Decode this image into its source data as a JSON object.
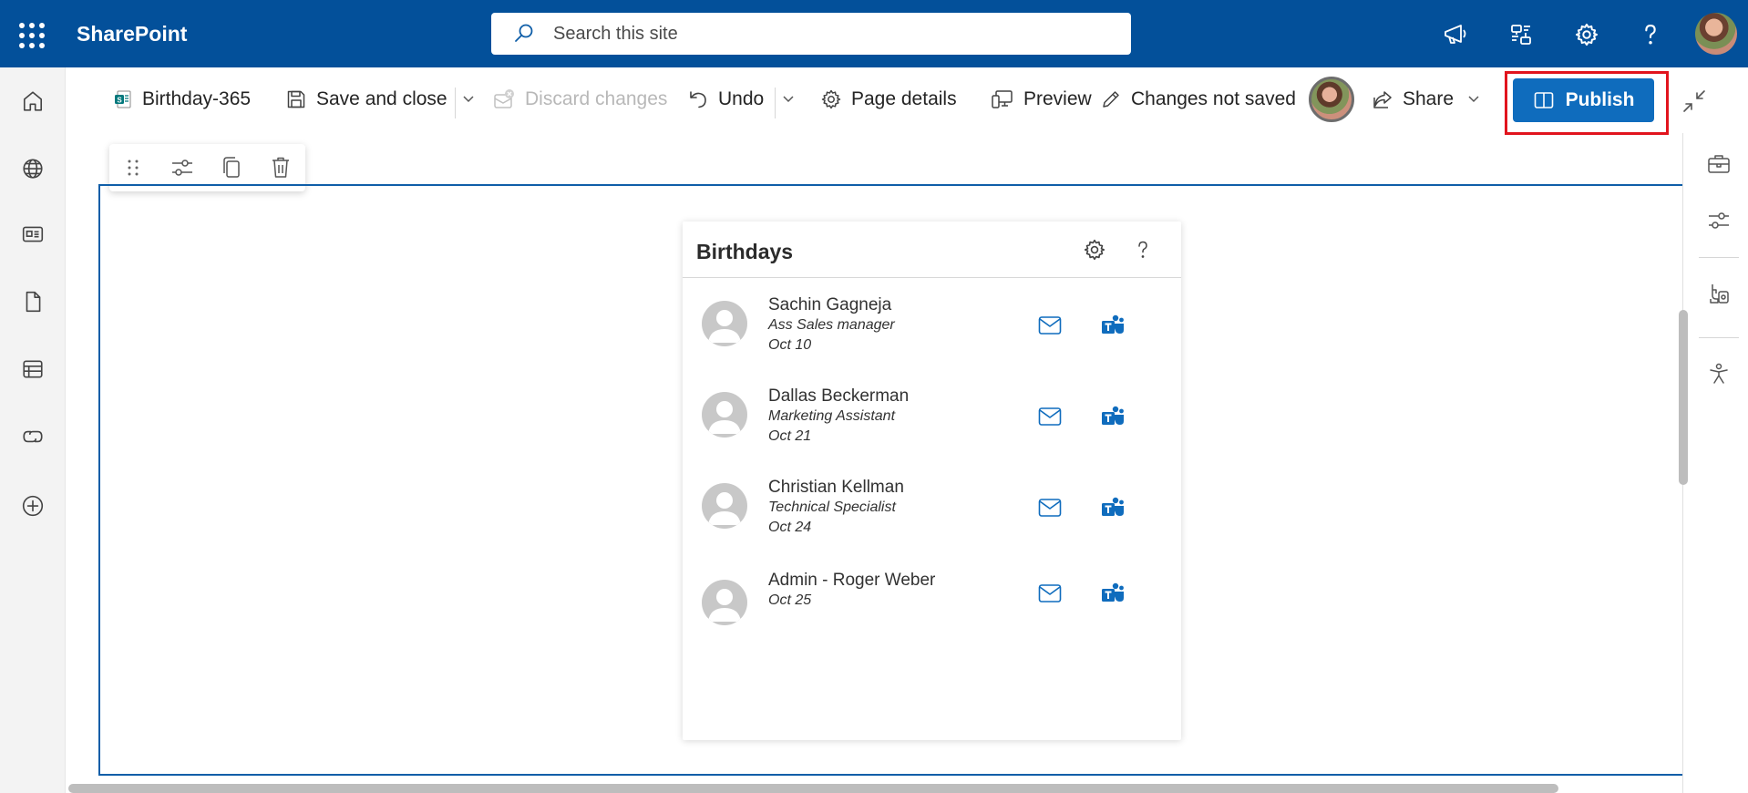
{
  "suite": {
    "brand": "SharePoint",
    "search_placeholder": "Search this site"
  },
  "command_bar": {
    "page_name": "Birthday-365",
    "save_close": "Save and close",
    "discard": "Discard changes",
    "undo": "Undo",
    "page_details": "Page details",
    "preview": "Preview",
    "status": "Changes not saved",
    "share": "Share",
    "publish": "Publish"
  },
  "webpart": {
    "title": "Birthdays",
    "people": [
      {
        "name": "Sachin Gagneja",
        "role": "Ass Sales manager",
        "date": "Oct 10"
      },
      {
        "name": "Dallas Beckerman",
        "role": "Marketing Assistant",
        "date": "Oct 21"
      },
      {
        "name": "Christian Kellman",
        "role": "Technical Specialist",
        "date": "Oct 24"
      },
      {
        "name": "Admin - Roger Weber",
        "role": "",
        "date": "Oct 25"
      }
    ]
  },
  "colors": {
    "suite_bar": "#03509a",
    "accent": "#0f6cbd",
    "highlight": "#e1141d"
  }
}
